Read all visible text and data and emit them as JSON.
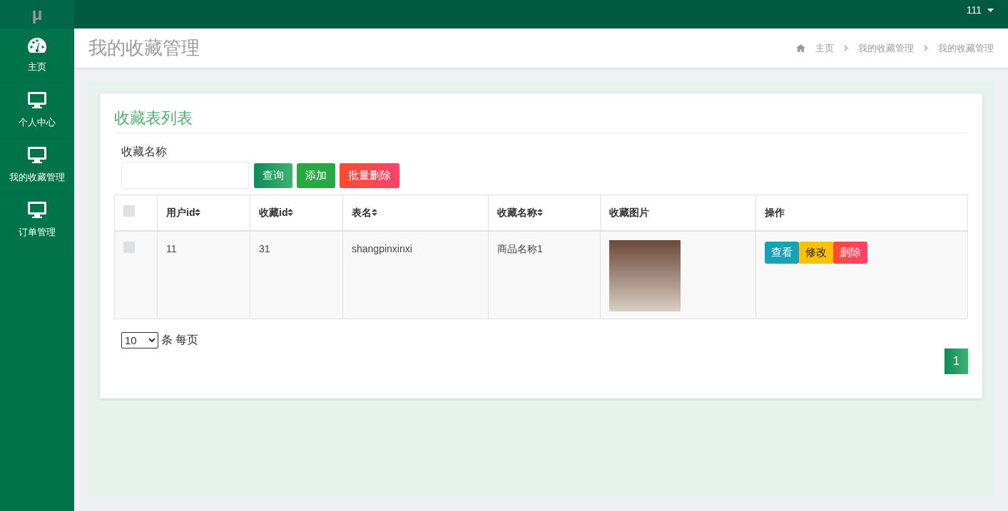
{
  "logo": "μ",
  "user_menu": {
    "label": "111"
  },
  "sidebar": {
    "items": [
      {
        "label": "主页",
        "kind": "dashboard"
      },
      {
        "label": "个人中心",
        "kind": "page"
      },
      {
        "label": "我的收藏管理",
        "kind": "page"
      },
      {
        "label": "订单管理",
        "kind": "page"
      }
    ]
  },
  "page_title": "我的收藏管理",
  "breadcrumb": [
    "主页",
    "我的收藏管理",
    "我的收藏管理"
  ],
  "card": {
    "title": "收藏表列表",
    "search": {
      "label": "收藏名称"
    },
    "buttons": [
      {
        "label": "查询",
        "kind": "search"
      },
      {
        "label": "添加",
        "kind": "add"
      },
      {
        "label": "批量删除",
        "kind": "delete"
      }
    ],
    "table": {
      "select_all_checked": false,
      "columns": [
        {
          "label": "用户id",
          "sortable": true
        },
        {
          "label": "收藏id",
          "sortable": true
        },
        {
          "label": "表名",
          "sortable": true
        },
        {
          "label": "收藏名称",
          "sortable": true
        },
        {
          "label": "收藏图片",
          "sortable": false
        },
        {
          "label": "操作",
          "sortable": false
        }
      ],
      "rows": [
        {
          "checked": false,
          "cells": [
            "11",
            "31",
            "shangpinxinxi",
            "商品名称1"
          ],
          "actions": [
            {
              "label": "查看",
              "kind": "view"
            },
            {
              "label": "修改",
              "kind": "edit"
            },
            {
              "label": "删除",
              "kind": "delete"
            }
          ]
        }
      ]
    },
    "page_size": {
      "value": "10",
      "suffix": "条 每页"
    },
    "pagination": [
      {
        "label": "1",
        "selected": true
      }
    ]
  }
}
